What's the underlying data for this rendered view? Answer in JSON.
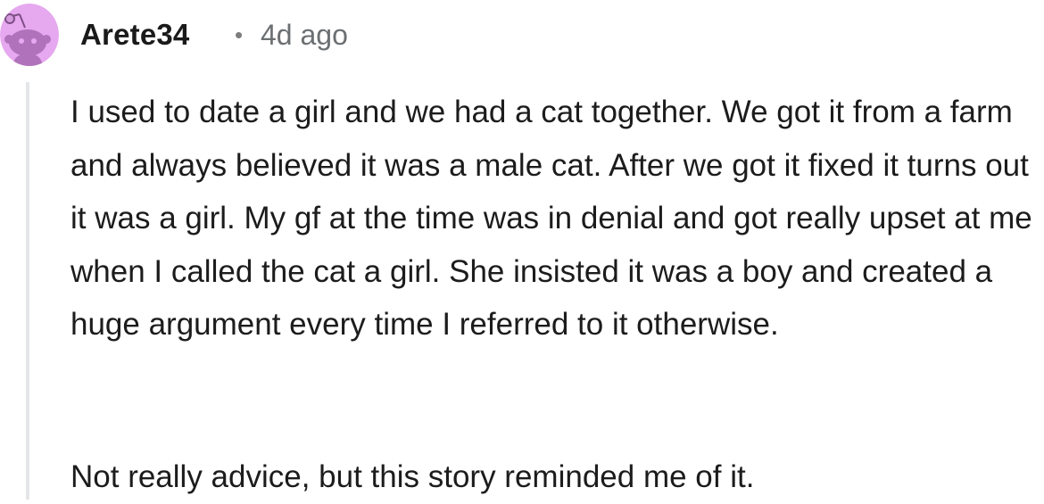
{
  "comment": {
    "author": "Arete34",
    "separator": "•",
    "timestamp": "4d ago",
    "avatar_icon": "reddit-snoo-avatar-icon",
    "avatar_bg": "#e6a8ef",
    "paragraphs": [
      "I used to date a girl and we had a cat together. We got it from a farm and always believed it was a male cat. After we got it fixed it turns out it was a girl. My gf at the time was in denial and got really upset at me when I called the cat a girl. She insisted it was a boy and created a huge argument every time I referred to it otherwise.",
      "Not really advice, but this story reminded me of it."
    ]
  }
}
